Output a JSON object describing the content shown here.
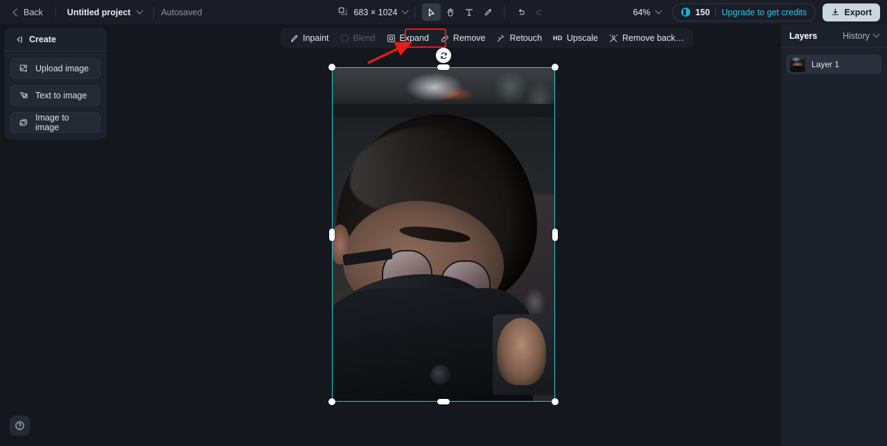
{
  "topbar": {
    "back_label": "Back",
    "project_name": "Untitled project",
    "autosave_status": "Autosaved",
    "canvas_dimensions": "683 × 1024",
    "zoom_level": "64%",
    "credits_count": "150",
    "credits_link": "Upgrade to get credits",
    "export_label": "Export",
    "tools": [
      {
        "name": "select-tool",
        "glyph": "cursor",
        "active": true
      },
      {
        "name": "hand-tool",
        "glyph": "hand",
        "active": false
      },
      {
        "name": "text-tool",
        "glyph": "T",
        "active": false
      },
      {
        "name": "brush-tool",
        "glyph": "brush",
        "active": false
      }
    ],
    "undo_label": "Undo",
    "redo_label": "Redo"
  },
  "left_panel": {
    "title": "Create",
    "collapse_icon": "collapse-panel-icon",
    "items": [
      {
        "label": "Upload image",
        "icon": "upload-image-icon"
      },
      {
        "label": "Text to image",
        "icon": "text-to-image-icon"
      },
      {
        "label": "Image to image",
        "icon": "image-to-image-icon"
      }
    ]
  },
  "action_toolbar": {
    "items": [
      {
        "label": "Inpaint",
        "icon": "inpaint-icon",
        "disabled": false,
        "highlighted": false
      },
      {
        "label": "Blend",
        "icon": "blend-icon",
        "disabled": true,
        "highlighted": false
      },
      {
        "label": "Expand",
        "icon": "expand-icon",
        "disabled": false,
        "highlighted": false
      },
      {
        "label": "Remove",
        "icon": "remove-icon",
        "disabled": false,
        "highlighted": true
      },
      {
        "label": "Retouch",
        "icon": "retouch-icon",
        "disabled": false,
        "highlighted": false
      },
      {
        "label": "Upscale",
        "icon": "hd-icon",
        "badge": "HD",
        "disabled": false,
        "highlighted": false
      },
      {
        "label": "Remove back…",
        "icon": "remove-background-icon",
        "disabled": false,
        "highlighted": false
      }
    ],
    "annotation_color": "#e81b1b"
  },
  "canvas": {
    "selection_color": "#22d3d3",
    "rotate_icon": "rotate-icon",
    "layer_image_alt": "portrait of person with glasses and black collar"
  },
  "right_panel": {
    "tab_layers": "Layers",
    "tab_history": "History",
    "layers": [
      {
        "name": "Layer 1"
      }
    ]
  },
  "help": {
    "icon": "help-icon",
    "label": "Help"
  }
}
